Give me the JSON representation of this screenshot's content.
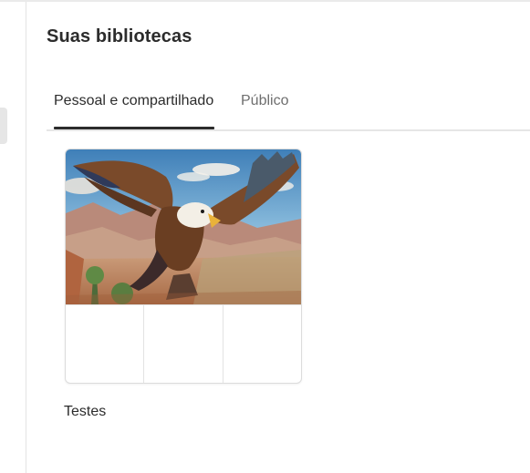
{
  "header": {
    "title": "Suas bibliotecas"
  },
  "tabs": [
    {
      "label": "Pessoal e compartilhado",
      "active": true
    },
    {
      "label": "Público",
      "active": false
    }
  ],
  "libraries": [
    {
      "name": "Testes",
      "thumbnail": "eagle-flying-over-canyon-image",
      "empty_slots": 3
    }
  ],
  "colors": {
    "text_primary": "#2c2c2c",
    "text_secondary": "#6e6e6e",
    "tab_indicator": "#2c2c2c",
    "divider": "#e6e6e6"
  }
}
